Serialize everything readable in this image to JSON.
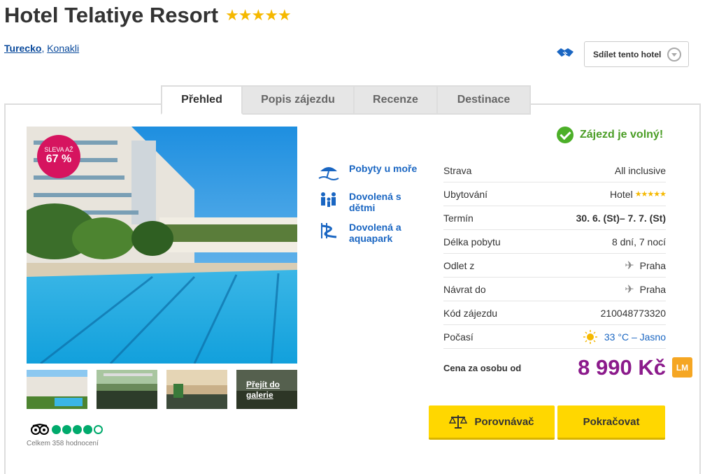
{
  "header": {
    "title": "Hotel Telatiye Resort",
    "stars": "★★★★★",
    "country": "Turecko",
    "separator": ",",
    "city": "Konakli",
    "share_label": "Sdílet tento hotel"
  },
  "tabs": [
    {
      "label": "Přehled"
    },
    {
      "label": "Popis zájezdu"
    },
    {
      "label": "Recenze"
    },
    {
      "label": "Destinace"
    }
  ],
  "gallery": {
    "badge_line1": "SLEVA AŽ",
    "badge_line2": "67 %",
    "gallery_link": "Přejít do galerie"
  },
  "tripadvisor": {
    "rating": 4,
    "max": 5,
    "count_text": "Celkem 358 hodnocení"
  },
  "features": [
    {
      "label": "Pobyty u moře",
      "icon": "beach-umbrella-icon"
    },
    {
      "label": "Dovolená s dětmi",
      "icon": "family-icon"
    },
    {
      "label": "Dovolená a aquapark",
      "icon": "water-slide-icon"
    }
  ],
  "availability": "Zájezd je volný!",
  "details": [
    {
      "key": "Strava",
      "value": "All inclusive"
    },
    {
      "key": "Ubytování",
      "value": "Hotel",
      "stars": "★★★★★"
    },
    {
      "key": "Termín",
      "value": "30. 6. (St)– 7. 7. (St)"
    },
    {
      "key": "Délka pobytu",
      "value": "8 dní, 7 nocí"
    },
    {
      "key": "Odlet z",
      "value": "Praha"
    },
    {
      "key": "Návrat do",
      "value": "Praha"
    },
    {
      "key": "Kód zájezdu",
      "value": "210048773320"
    },
    {
      "key": "Počasí",
      "value": "33 °C – Jasno"
    }
  ],
  "price": {
    "label": "Cena za osobu od",
    "value": "8 990 Kč",
    "badge": "LM"
  },
  "buttons": {
    "compare": "Porovnávač",
    "continue": "Pokračovat"
  },
  "colors": {
    "price": "#8b1a8b",
    "available": "#4a9d25",
    "cta": "#ffd700",
    "link": "#1a66c2"
  }
}
